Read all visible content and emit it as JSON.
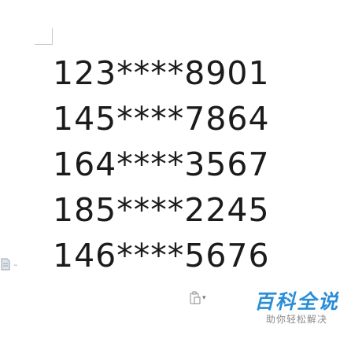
{
  "document": {
    "lines": [
      "123****8901",
      "145****7864",
      "164****3567",
      "185****2245",
      "146****5676"
    ]
  },
  "watermark": {
    "title": "百科全说",
    "subtitle": "助你轻松解决"
  },
  "colors": {
    "text": "#1b1b1b",
    "logo": "#2a8dd6",
    "icon": "#9aa3ad"
  },
  "icons": {
    "paragraph": "paragraph-options-icon",
    "paste": "paste-options-icon"
  }
}
